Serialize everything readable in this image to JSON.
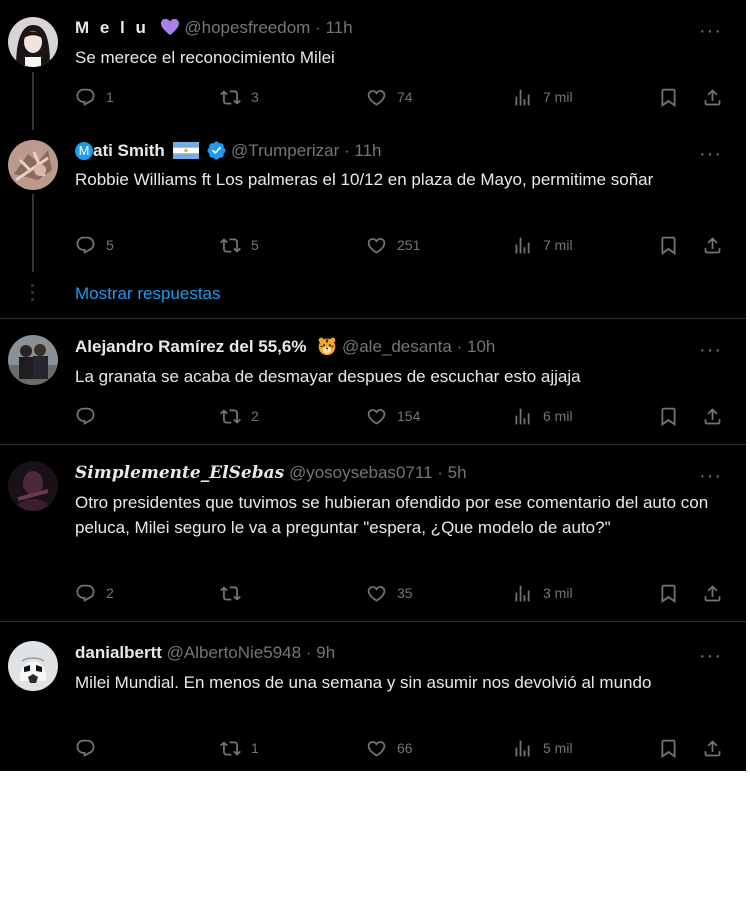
{
  "tweets": [
    {
      "name": "M e l u",
      "handle": "@hopesfreedom",
      "time": "11h",
      "text": "Se merece el reconocimiento Milei",
      "replies": "1",
      "retweets": "3",
      "likes": "74",
      "views": "7 mil"
    },
    {
      "name_prefix": "M",
      "name": "ati Smith",
      "handle": "@Trumperizar",
      "time": "11h",
      "text": "Robbie Williams ft Los palmeras el 10/12 en plaza de Mayo, permitime soñar",
      "replies": "5",
      "retweets": "5",
      "likes": "251",
      "views": "7 mil"
    },
    {
      "name": "Alejandro Ramírez del 55,6%",
      "handle": "@ale_desanta",
      "time": "10h",
      "text": "La granata se acaba de desmayar despues de escuchar esto ajjaja",
      "replies": "",
      "retweets": "2",
      "likes": "154",
      "views": "6 mil"
    },
    {
      "name": "Simplemente_ElSebas",
      "handle": "@yosoysebas0711",
      "time": "5h",
      "text": "Otro presidentes que tuvimos se hubieran ofendido por ese comentario del auto con peluca, Milei seguro le va a preguntar \"espera, ¿Que modelo de auto?\"",
      "replies": "2",
      "retweets": "",
      "likes": "35",
      "views": "3 mil"
    },
    {
      "name": "danialbertt",
      "handle": "@AlbertoNie5948",
      "time": "9h",
      "text": "Milei Mundial. En menos de una semana y sin asumir nos devolvió al mundo",
      "replies": "",
      "retweets": "1",
      "likes": "66",
      "views": "5 mil"
    }
  ],
  "show_replies": "Mostrar respuestas",
  "dot": "·",
  "more": "···",
  "colors": {
    "background": "#000000",
    "text": "#e7e9ea",
    "muted": "#71767b",
    "link": "#1d9bf0",
    "separator": "#2f3336"
  },
  "icons": [
    "reply-icon",
    "retweet-icon",
    "like-icon",
    "views-icon",
    "bookmark-icon",
    "share-icon",
    "more-icon",
    "verified-badge-icon"
  ]
}
